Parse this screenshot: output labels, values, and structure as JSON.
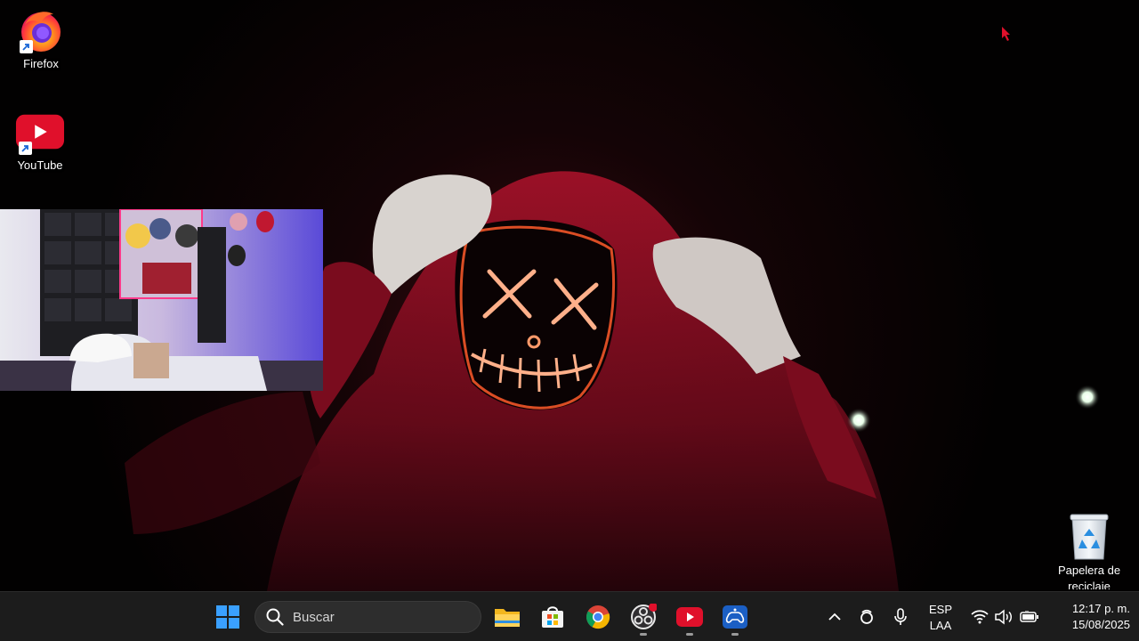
{
  "desktop": {
    "icons": [
      {
        "label": "Firefox",
        "icon": "firefox-icon"
      },
      {
        "label": "YouTube",
        "icon": "youtube-icon"
      }
    ],
    "recycle_bin": {
      "label": "Papelera de reciclaje",
      "icon": "recycle-bin-icon"
    }
  },
  "taskbar": {
    "search_placeholder": "Buscar",
    "pinned": [
      {
        "name": "start",
        "icon": "windows-start-icon",
        "running": false
      },
      {
        "name": "file-explorer",
        "icon": "folder-icon",
        "running": false
      },
      {
        "name": "microsoft-store",
        "icon": "store-icon",
        "running": false
      },
      {
        "name": "chrome",
        "icon": "chrome-icon",
        "running": false
      },
      {
        "name": "obs-studio",
        "icon": "obs-icon",
        "running": true,
        "badge": true
      },
      {
        "name": "youtube",
        "icon": "youtube-icon",
        "running": true
      },
      {
        "name": "game-app",
        "icon": "controller-icon",
        "running": true
      }
    ],
    "tray": {
      "language_line1": "ESP",
      "language_line2": "LAA",
      "time": "12:17 p. m.",
      "date": "15/08/2025"
    }
  },
  "colors": {
    "taskbar_bg": "#1c1c1c",
    "accent_red": "#e0102b",
    "windows_blue": "#3aa0ff"
  }
}
